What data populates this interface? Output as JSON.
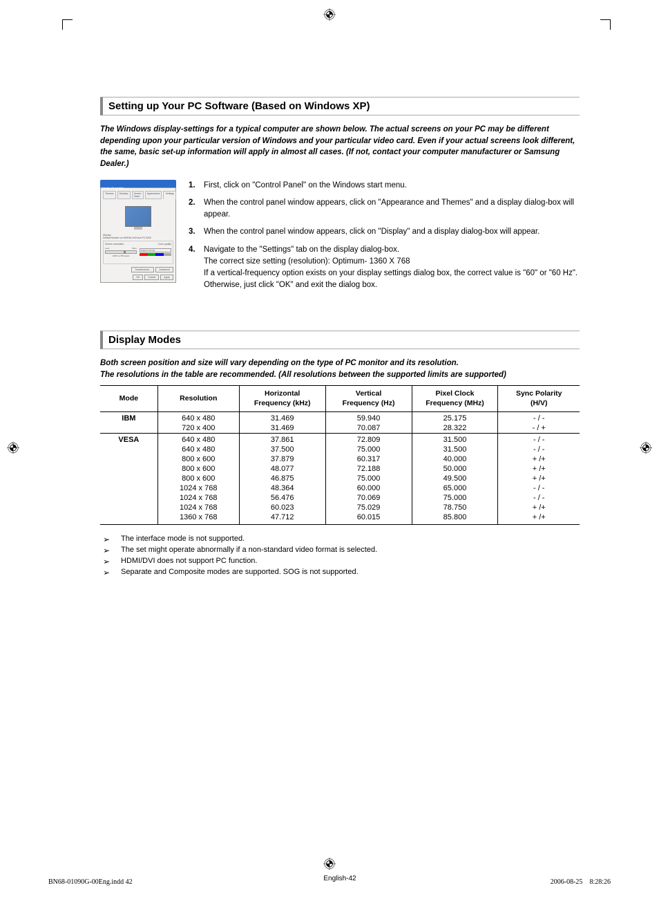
{
  "section1": {
    "heading": "Setting up Your PC Software (Based on Windows XP)",
    "intro": "The Windows display-settings for a typical computer are shown below. The actual screens on your PC may be different depending upon your particular version of Windows and your particular video card. Even if your actual screens look different, the same, basic set-up information will apply in almost all cases. (If not, contact your computer manufacturer or Samsung Dealer.)",
    "steps": [
      {
        "num": "1.",
        "text": "First, click on \"Control Panel\" on the Windows start menu."
      },
      {
        "num": "2.",
        "text": "When the control panel window appears, click on \"Appearance and Themes\" and a display dialog-box will appear."
      },
      {
        "num": "3.",
        "text": "When the control panel window appears, click on \"Display\" and a display dialog-box will appear."
      },
      {
        "num": "4.",
        "text": "Navigate to the \"Settings\" tab on the display dialog-box.\nThe correct size setting (resolution): Optimum- 1360 X 768\nIf a vertical-frequency option exists on your display settings dialog box, the correct value is \"60\" or \"60 Hz\". Otherwise, just click \"OK\" and exit the dialog box."
      }
    ],
    "dialog": {
      "title": "Display Properties",
      "tabs": [
        "Themes",
        "Desktop",
        "Screen Saver",
        "Appearance",
        "Settings"
      ],
      "display_label": "Display",
      "display_value": "Default Monitor on NVIDIA GeForce FX 5200",
      "res_label": "Screen resolution",
      "res_value": "1360 by 768 pixels",
      "less": "Less",
      "more": "More",
      "color_label": "Color quality",
      "color_value": "Highest (32 bit)",
      "troubleshoot": "Troubleshoot...",
      "advanced": "Advanced",
      "ok": "OK",
      "cancel": "Cancel",
      "apply": "Apply"
    }
  },
  "section2": {
    "heading": "Display Modes",
    "intro1": "Both screen position and size will vary depending on the type of PC monitor and its resolution.",
    "intro2": "The resolutions in the table are recommended. (All resolutions between the supported limits are supported)",
    "headers": {
      "mode": "Mode",
      "resolution": "Resolution",
      "hfreq": "Horizontal Frequency (kHz)",
      "vfreq": "Vertical Frequency (Hz)",
      "pclk": "Pixel Clock Frequency (MHz)",
      "sync": "Sync Polarity (H/V)"
    },
    "groups": [
      {
        "mode": "IBM",
        "rows": [
          {
            "res": "640 x 480",
            "h": "31.469",
            "v": "59.940",
            "p": "25.175",
            "s": "- / -"
          },
          {
            "res": "720 x 400",
            "h": "31.469",
            "v": "70.087",
            "p": "28.322",
            "s": "- / +"
          }
        ]
      },
      {
        "mode": "VESA",
        "rows": [
          {
            "res": "640 x 480",
            "h": "37.861",
            "v": "72.809",
            "p": "31.500",
            "s": "- / -"
          },
          {
            "res": "640 x 480",
            "h": "37.500",
            "v": "75.000",
            "p": "31.500",
            "s": "- / -"
          },
          {
            "res": "800 x 600",
            "h": "37.879",
            "v": "60.317",
            "p": "40.000",
            "s": "+ /+"
          },
          {
            "res": "800 x 600",
            "h": "48.077",
            "v": "72.188",
            "p": "50.000",
            "s": "+ /+"
          },
          {
            "res": "800 x 600",
            "h": "46.875",
            "v": "75.000",
            "p": "49.500",
            "s": "+ /+"
          },
          {
            "res": "1024 x 768",
            "h": "48.364",
            "v": "60.000",
            "p": "65.000",
            "s": "- / -"
          },
          {
            "res": "1024 x 768",
            "h": "56.476",
            "v": "70.069",
            "p": "75.000",
            "s": "- / -"
          },
          {
            "res": "1024 x 768",
            "h": "60.023",
            "v": "75.029",
            "p": "78.750",
            "s": "+ /+"
          },
          {
            "res": "1360 x 768",
            "h": "47.712",
            "v": "60.015",
            "p": "85.800",
            "s": "+ /+"
          }
        ]
      }
    ],
    "notes": [
      "The interface mode is not supported.",
      "The set might operate abnormally if a non-standard video format is selected.",
      "HDMI/DVI does not support PC function.",
      "Separate and Composite modes are supported. SOG is not supported."
    ]
  },
  "page_number": "English-42",
  "footer": {
    "file": "BN68-01090G-00Eng.indd   42",
    "date": "2006-08-25",
    "time": "8:28:26"
  }
}
